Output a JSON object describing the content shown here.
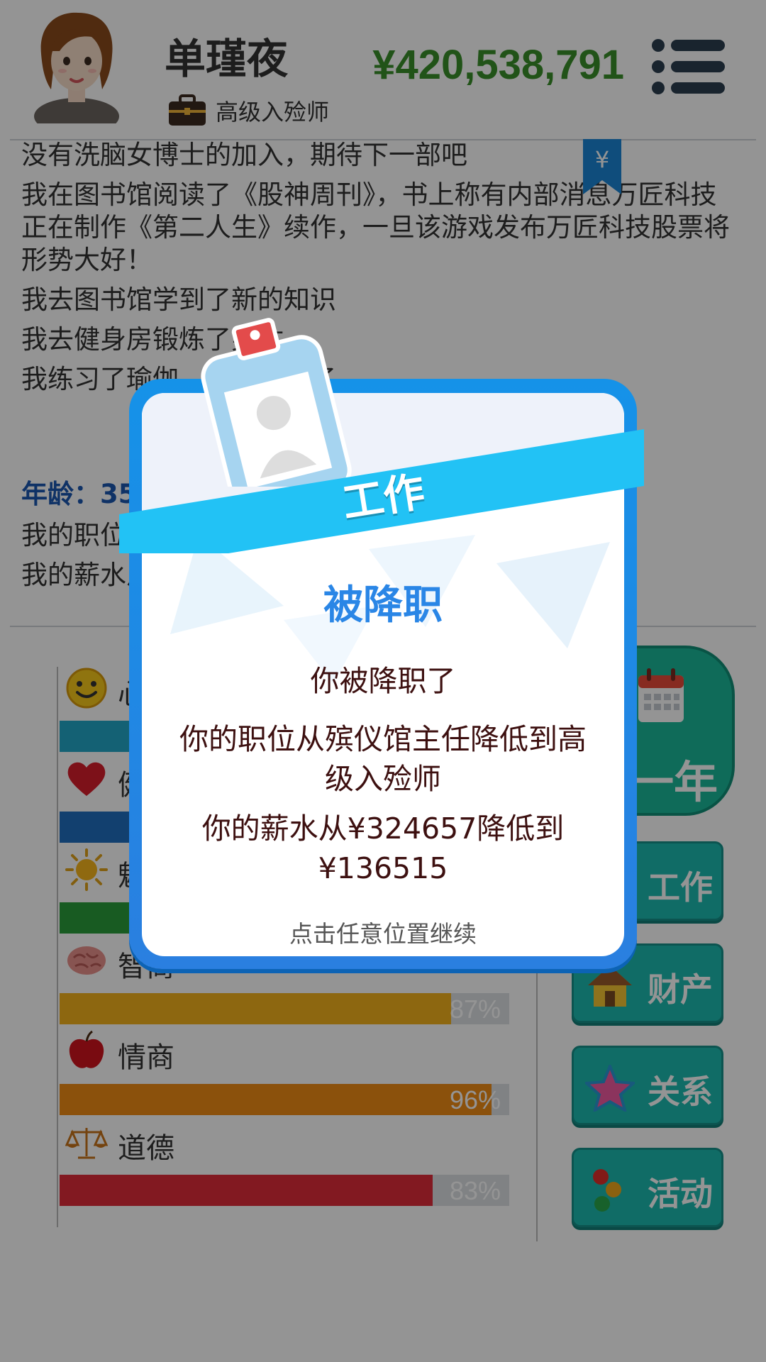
{
  "header": {
    "player_name": "单瑾夜",
    "job_title": "高级入殓师",
    "money": "¥420,538,791"
  },
  "log": {
    "lines": [
      "没有洗脑女博士的加入，期待下一部吧",
      "我在图书馆阅读了《股神周刊》，书上称有内部消息万匠科技正在制作《第二人生》续作，一旦该游戏发布万匠科技股票将形势大好！",
      "我去图书馆学到了新的知识",
      "我去健身房锻炼了身体",
      "我练习了瑜伽，身心放松了"
    ],
    "stock_tag": "¥",
    "age": "年龄：35岁",
    "position_line": "我的职位从殡仪馆主任降低到高级入殓师",
    "salary_line": "我的薪水从¥324657降低到¥136515"
  },
  "stats": [
    {
      "label": "心情",
      "percent": 100,
      "percent_text": "",
      "color": "#23a8c9",
      "icon": "smiley-icon"
    },
    {
      "label": "健康",
      "percent": 100,
      "percent_text": "",
      "color": "#1f6fc0",
      "icon": "heart-icon"
    },
    {
      "label": "魅力",
      "percent": 100,
      "percent_text": "",
      "color": "#2a9d3c",
      "icon": "sun-icon"
    },
    {
      "label": "智商",
      "percent": 87,
      "percent_text": "87%",
      "color": "#f3b11c",
      "icon": "brain-icon"
    },
    {
      "label": "情商",
      "percent": 96,
      "percent_text": "96%",
      "color": "#f08c16",
      "icon": "apple-icon"
    },
    {
      "label": "道德",
      "percent": 83,
      "percent_text": "83%",
      "color": "#e02b3a",
      "icon": "scales-icon"
    }
  ],
  "side_buttons": {
    "year": "一年",
    "work": "工作",
    "property": "财产",
    "relations": "关系",
    "activities": "活动"
  },
  "modal": {
    "ribbon_title": "工作",
    "heading": "被降职",
    "line1": "你被降职了",
    "line2": "你的职位从殡仪馆主任降低到高级入殓师",
    "line3": "你的薪水从¥324657降低到¥136515",
    "footer": "点击任意位置继续"
  }
}
